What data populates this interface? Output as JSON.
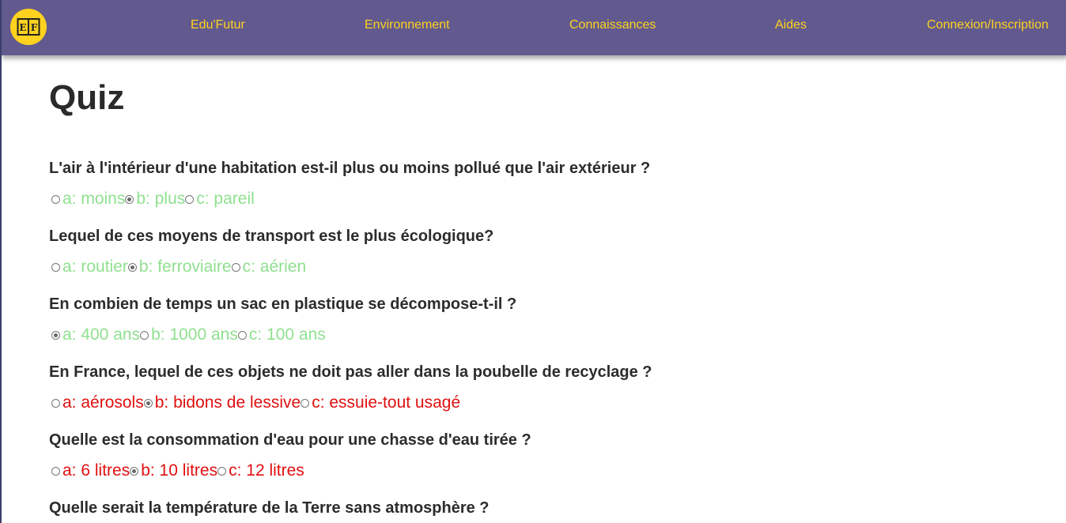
{
  "colors": {
    "navbar": "#625a8e",
    "accent": "#ffd21f",
    "correct": "#90e090",
    "wrong": "#e01010",
    "text": "#2c2c2c"
  },
  "nav": {
    "logo_icon": "book-icon",
    "links": [
      "Edu'Futur",
      "Environnement",
      "Connaissances",
      "Aides",
      "Connexion/Inscription"
    ]
  },
  "page": {
    "title": "Quiz"
  },
  "questions": [
    {
      "text": "L'air à l'intérieur d'une habitation est-il plus ou moins pollué que l'air extérieur ?",
      "status": "correct",
      "selected": 1,
      "options": [
        "a: moins",
        "b: plus",
        "c: pareil"
      ]
    },
    {
      "text": "Lequel de ces moyens de transport est le plus écologique?",
      "status": "correct",
      "selected": 1,
      "options": [
        "a: routier",
        "b: ferroviaire",
        "c: aérien"
      ]
    },
    {
      "text": "En combien de temps un sac en plastique se décompose-t-il ?",
      "status": "correct",
      "selected": 0,
      "options": [
        "a: 400 ans ",
        "b: 1000 ans",
        "c: 100 ans"
      ]
    },
    {
      "text": "En France, lequel de ces objets ne doit pas aller dans la poubelle de recyclage ?",
      "status": "wrong",
      "selected": 1,
      "options": [
        "a: aérosols",
        "b: bidons de lessive",
        "c: essuie-tout usagé"
      ]
    },
    {
      "text": "Quelle est la consommation d'eau pour une chasse d'eau tirée ?",
      "status": "wrong",
      "selected": 1,
      "options": [
        "a: 6 litres",
        "b: 10 litres",
        "c: 12 litres"
      ]
    },
    {
      "text": "Quelle serait la température de la Terre sans atmosphère ?",
      "status": "none",
      "selected": -1,
      "options": []
    }
  ]
}
